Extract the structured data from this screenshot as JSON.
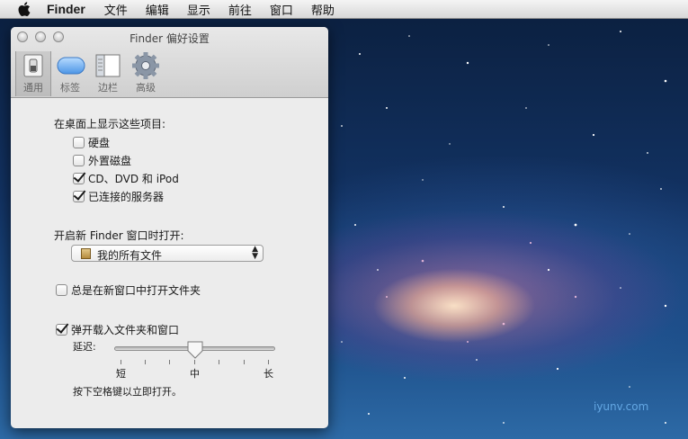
{
  "menubar": {
    "app": "Finder",
    "items": [
      "文件",
      "编辑",
      "显示",
      "前往",
      "窗口",
      "帮助"
    ]
  },
  "window": {
    "title": "Finder 偏好设置",
    "toolbar": [
      {
        "label": "通用",
        "icon": "general-switch-icon",
        "selected": true
      },
      {
        "label": "标签",
        "icon": "tag-icon",
        "selected": false
      },
      {
        "label": "边栏",
        "icon": "sidebar-icon",
        "selected": false
      },
      {
        "label": "高级",
        "icon": "gear-icon",
        "selected": false
      }
    ],
    "desktop_heading": "在桌面上显示这些项目:",
    "desktop_items": [
      {
        "label": "硬盘",
        "checked": false
      },
      {
        "label": "外置磁盘",
        "checked": false
      },
      {
        "label": "CD、DVD 和 iPod",
        "checked": true
      },
      {
        "label": "已连接的服务器",
        "checked": true
      }
    ],
    "new_window_heading": "开启新 Finder 窗口时打开:",
    "new_window_value": "我的所有文件",
    "always_new_window": {
      "label": "总是在新窗口中打开文件夹",
      "checked": false
    },
    "spring_loaded": {
      "label": "弹开载入文件夹和窗口",
      "checked": true
    },
    "delay_label": "延迟:",
    "delay_level": 0.5,
    "delay_ticks": [
      "短",
      "中",
      "长"
    ],
    "hint": "按下空格键以立即打开。"
  },
  "watermark": "iyunv.com",
  "colors": {
    "selection": "#3b6fd6",
    "window_bg": "#ececec"
  }
}
